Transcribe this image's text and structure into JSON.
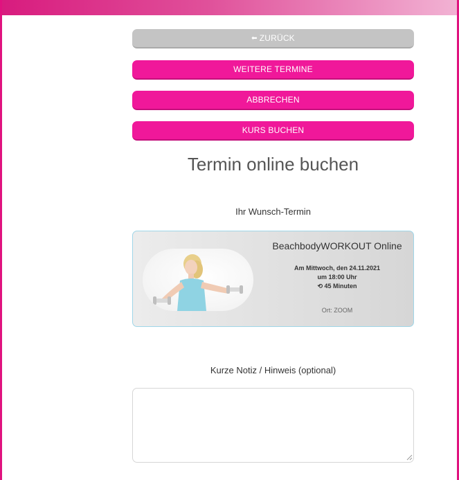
{
  "buttons": {
    "back": "ZURÜCK",
    "more_dates": "WEITERE TERMINE",
    "cancel": "ABBRECHEN",
    "book": "KURS BUCHEN"
  },
  "heading": "Termin online buchen",
  "wish_label": "Ihr Wunsch-Termin",
  "course": {
    "name": "BeachbodyWORKOUT Online",
    "date": "Am Mittwoch, den 24.11.2021",
    "time": "um 18:00 Uhr",
    "duration": "45 Minuten",
    "location": "Ort: ZOOM"
  },
  "note": {
    "label": "Kurze Notiz / Hinweis (optional)",
    "value": ""
  },
  "colors": {
    "accent": "#f0189a",
    "frame": "#e0127f",
    "grey_button": "#c4c4c4",
    "card_border": "#9fd6e8"
  },
  "icons": [
    "back-arrow-icon",
    "clock-rewind-icon",
    "resize-grip-icon"
  ]
}
